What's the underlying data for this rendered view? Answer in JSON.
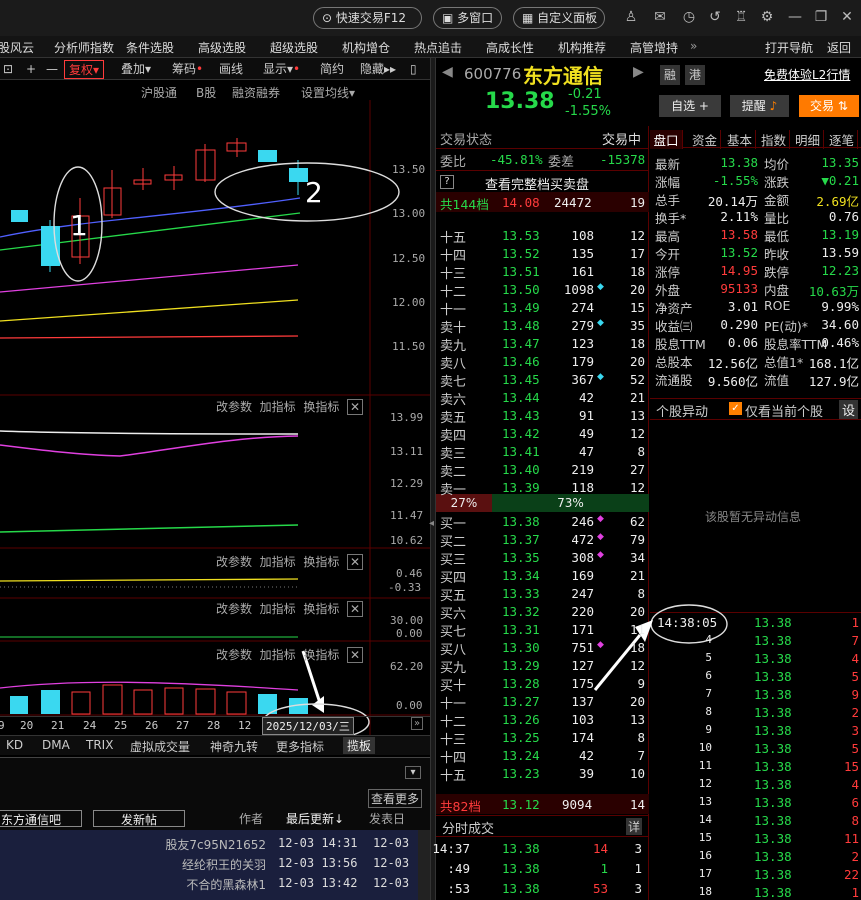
{
  "top": {
    "quick_trade": "快速交易F12",
    "multi_window": "多窗口",
    "custom_board": "自定义面板"
  },
  "menu": [
    "股风云",
    "分析师指数",
    "条件选股",
    "高级选股",
    "超级选股",
    "机构增仓",
    "热点追击",
    "高成长性",
    "机构推荐",
    "高管增持",
    "打开导航",
    "返回"
  ],
  "chart_toolbar": {
    "fq": "复权",
    "overlay": "叠加",
    "chips": "筹码",
    "draw": "画线",
    "show": "显示",
    "simple": "简约",
    "hide": "隐藏"
  },
  "chart_sub": {
    "hgt": "沪股通",
    "b": "B股",
    "rz": "融资融券",
    "ma": "设置均线"
  },
  "price_axis": [
    "13.50",
    "13.00",
    "12.50",
    "12.00",
    "11.50"
  ],
  "ind_axis": [
    [
      "13.99",
      "13.11",
      "12.29",
      "11.47",
      "10.62"
    ],
    [
      "0.46",
      "-0.33"
    ],
    [
      "30.00",
      "0.00"
    ],
    [
      "62.20",
      "0.00"
    ]
  ],
  "ind_tools": {
    "param": "改参数",
    "add": "加指标",
    "change": "换指标"
  },
  "dates": [
    "9",
    "20",
    "21",
    "24",
    "25",
    "26",
    "27",
    "28",
    "12"
  ],
  "date_tip": "2025/12/03/三",
  "ind_tabs": [
    "KD",
    "DMA",
    "TRIX",
    "虚拟成交量",
    "神奇九转",
    "更多指标",
    "揽板"
  ],
  "bbs": {
    "more": "查看更多",
    "name": "东方通信吧",
    "post": "发新帖",
    "author": "作者",
    "latest": "最后更新",
    "posted": "发表日",
    "rows": [
      [
        "股友7c95N21652",
        "12-03 14:31",
        "12-03"
      ],
      [
        "经纶积王的关羽",
        "12-03 13:56",
        "12-03"
      ],
      [
        "不合的黑森林1",
        "12-03 13:42",
        "12-03"
      ]
    ]
  },
  "annot": {
    "a1": "1",
    "a2": "2"
  },
  "stock": {
    "code": "600776",
    "name": "东方通信",
    "price": "13.38",
    "chg": "-0.21",
    "pct": "-1.55%",
    "rong": "融",
    "gang": "港",
    "free": "免费体验L2行情",
    "zixuan": "自选 +",
    "remind": "提醒",
    "trade": "交易"
  },
  "ob": {
    "status_l": "交易状态",
    "status_r": "交易中",
    "wb_l": "委比",
    "wb": "-45.81%",
    "wc_l": "委差",
    "wc": "-15378",
    "full": "查看完整档买卖盘",
    "sell_tot": [
      "共144档",
      "14.08",
      "24472",
      "19"
    ],
    "buy_tot": [
      "共82档",
      "13.12",
      "9094",
      "14"
    ],
    "pct": [
      "27%",
      "73%"
    ]
  },
  "asks": [
    [
      "十五",
      "13.53",
      "108",
      "12"
    ],
    [
      "十四",
      "13.52",
      "135",
      "17"
    ],
    [
      "十三",
      "13.51",
      "161",
      "18"
    ],
    [
      "十二",
      "13.50",
      "1098",
      "20"
    ],
    [
      "十一",
      "13.49",
      "274",
      "15"
    ],
    [
      "卖十",
      "13.48",
      "279",
      "35"
    ],
    [
      "卖九",
      "13.47",
      "123",
      "18"
    ],
    [
      "卖八",
      "13.46",
      "179",
      "20"
    ],
    [
      "卖七",
      "13.45",
      "367",
      "52"
    ],
    [
      "卖六",
      "13.44",
      "42",
      "21"
    ],
    [
      "卖五",
      "13.43",
      "91",
      "13"
    ],
    [
      "卖四",
      "13.42",
      "49",
      "12"
    ],
    [
      "卖三",
      "13.41",
      "47",
      "8"
    ],
    [
      "卖二",
      "13.40",
      "219",
      "27"
    ],
    [
      "卖一",
      "13.39",
      "118",
      "12"
    ]
  ],
  "bids": [
    [
      "买一",
      "13.38",
      "246",
      "62"
    ],
    [
      "买二",
      "13.37",
      "472",
      "79"
    ],
    [
      "买三",
      "13.35",
      "308",
      "34"
    ],
    [
      "买四",
      "13.34",
      "169",
      "21"
    ],
    [
      "买五",
      "13.33",
      "247",
      "8"
    ],
    [
      "买六",
      "13.32",
      "220",
      "20"
    ],
    [
      "买七",
      "13.31",
      "171",
      "11"
    ],
    [
      "买八",
      "13.30",
      "751",
      "18"
    ],
    [
      "买九",
      "13.29",
      "127",
      "12"
    ],
    [
      "买十",
      "13.28",
      "175",
      "9"
    ],
    [
      "十一",
      "13.27",
      "137",
      "20"
    ],
    [
      "十二",
      "13.26",
      "103",
      "13"
    ],
    [
      "十三",
      "13.25",
      "174",
      "8"
    ],
    [
      "十四",
      "13.24",
      "42",
      "7"
    ],
    [
      "十五",
      "13.23",
      "39",
      "10"
    ]
  ],
  "ticks_head": "分时成交",
  "ticks_btn": "详",
  "ticks": [
    [
      "14:37",
      "13.38",
      "14",
      "3"
    ],
    [
      ":49",
      "13.38",
      "1",
      "1"
    ],
    [
      ":53",
      "13.38",
      "53",
      "3"
    ]
  ],
  "tabs": [
    "盘口",
    "资金",
    "基本",
    "指数",
    "明细",
    "逐笔"
  ],
  "quote": [
    [
      "最新",
      "13.38",
      "均价",
      "13.35"
    ],
    [
      "涨幅",
      "-1.55%",
      "涨跌",
      "▼0.21"
    ],
    [
      "总手",
      "20.14万",
      "金额",
      "2.69亿"
    ],
    [
      "换手*",
      "2.11%",
      "量比",
      "0.76"
    ],
    [
      "最高",
      "13.58",
      "最低",
      "13.19"
    ],
    [
      "今开",
      "13.52",
      "昨收",
      "13.59"
    ],
    [
      "涨停",
      "14.95",
      "跌停",
      "12.23"
    ],
    [
      "外盘",
      "95133",
      "内盘",
      "10.63万"
    ],
    [
      "净资产",
      "3.01",
      "ROE",
      "9.99%"
    ],
    [
      "收益㈢",
      "0.290",
      "PE(动)*",
      "34.60"
    ],
    [
      "股息TTM",
      "0.06",
      "股息率TTM",
      "0.46%"
    ],
    [
      "总股本",
      "12.56亿",
      "总值1*",
      "168.1亿"
    ],
    [
      "流通股",
      "9.560亿",
      "流值",
      "127.9亿"
    ]
  ],
  "anomaly": {
    "title": "个股异动",
    "only": "仅看当前个股",
    "set": "设",
    "empty": "该股暂无异动信息"
  },
  "detail": {
    "time": "14:38:05",
    "rows": [
      [
        "4",
        "13.38",
        "7"
      ],
      [
        "5",
        "13.38",
        "4"
      ],
      [
        "6",
        "13.38",
        "5"
      ],
      [
        "7",
        "13.38",
        "9"
      ],
      [
        "8",
        "13.38",
        "2"
      ],
      [
        "9",
        "13.38",
        "3"
      ],
      [
        "10",
        "13.38",
        "5"
      ],
      [
        "11",
        "13.38",
        "15"
      ],
      [
        "12",
        "13.38",
        "4"
      ],
      [
        "13",
        "13.38",
        "6"
      ],
      [
        "14",
        "13.38",
        "8"
      ],
      [
        "15",
        "13.38",
        "11"
      ],
      [
        "16",
        "13.38",
        "2"
      ],
      [
        "17",
        "13.38",
        "22"
      ],
      [
        "18",
        "13.38",
        "1"
      ]
    ],
    "first": [
      "13.38",
      "1"
    ]
  },
  "colors": {
    "up": "#ff3b3b",
    "down": "#26d94a",
    "flat": "#eeeeee",
    "accent": "#ff8000"
  }
}
